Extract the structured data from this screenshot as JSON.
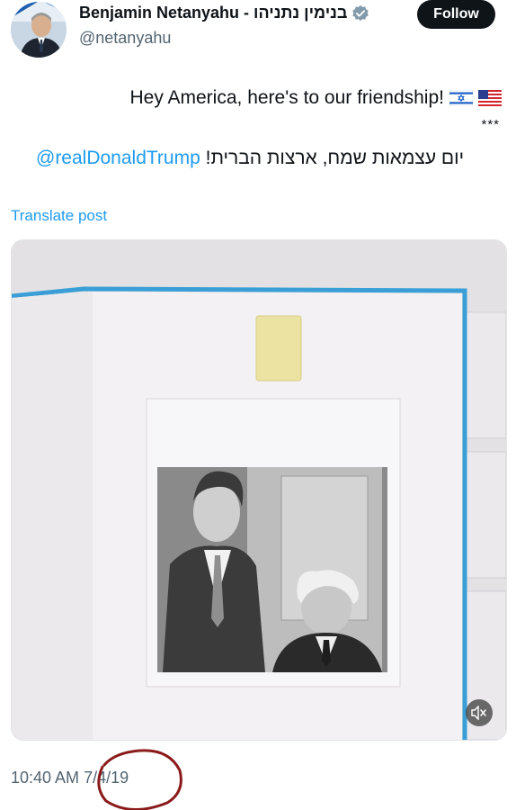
{
  "author": {
    "display_name": "Benjamin Netanyahu - בנימין נתניהו",
    "handle": "@netanyahu",
    "verified_icon": "verified-badge-icon",
    "avatar_icon": "profile-photo"
  },
  "follow_button": {
    "label": "Follow"
  },
  "tweet": {
    "line1": "Hey America, here's to our friendship!",
    "line1_flags": [
      "israel-flag-icon",
      "us-flag-icon"
    ],
    "separator": "***",
    "hebrew_text": "יום עצמאות שמח, ארצות הברית!",
    "mention": "@realDonaldTrump"
  },
  "translate": {
    "label": "Translate post"
  },
  "media": {
    "mute_icon": "speaker-muted-icon",
    "photo_description_icon": "framed-photograph"
  },
  "footer": {
    "time": "10:40 AM",
    "date": "7/4/19",
    "annotation_color": "#8b1a1a"
  },
  "colors": {
    "link": "#1d9bf0",
    "muted_text": "#536471",
    "follow_bg": "#0f1419"
  }
}
